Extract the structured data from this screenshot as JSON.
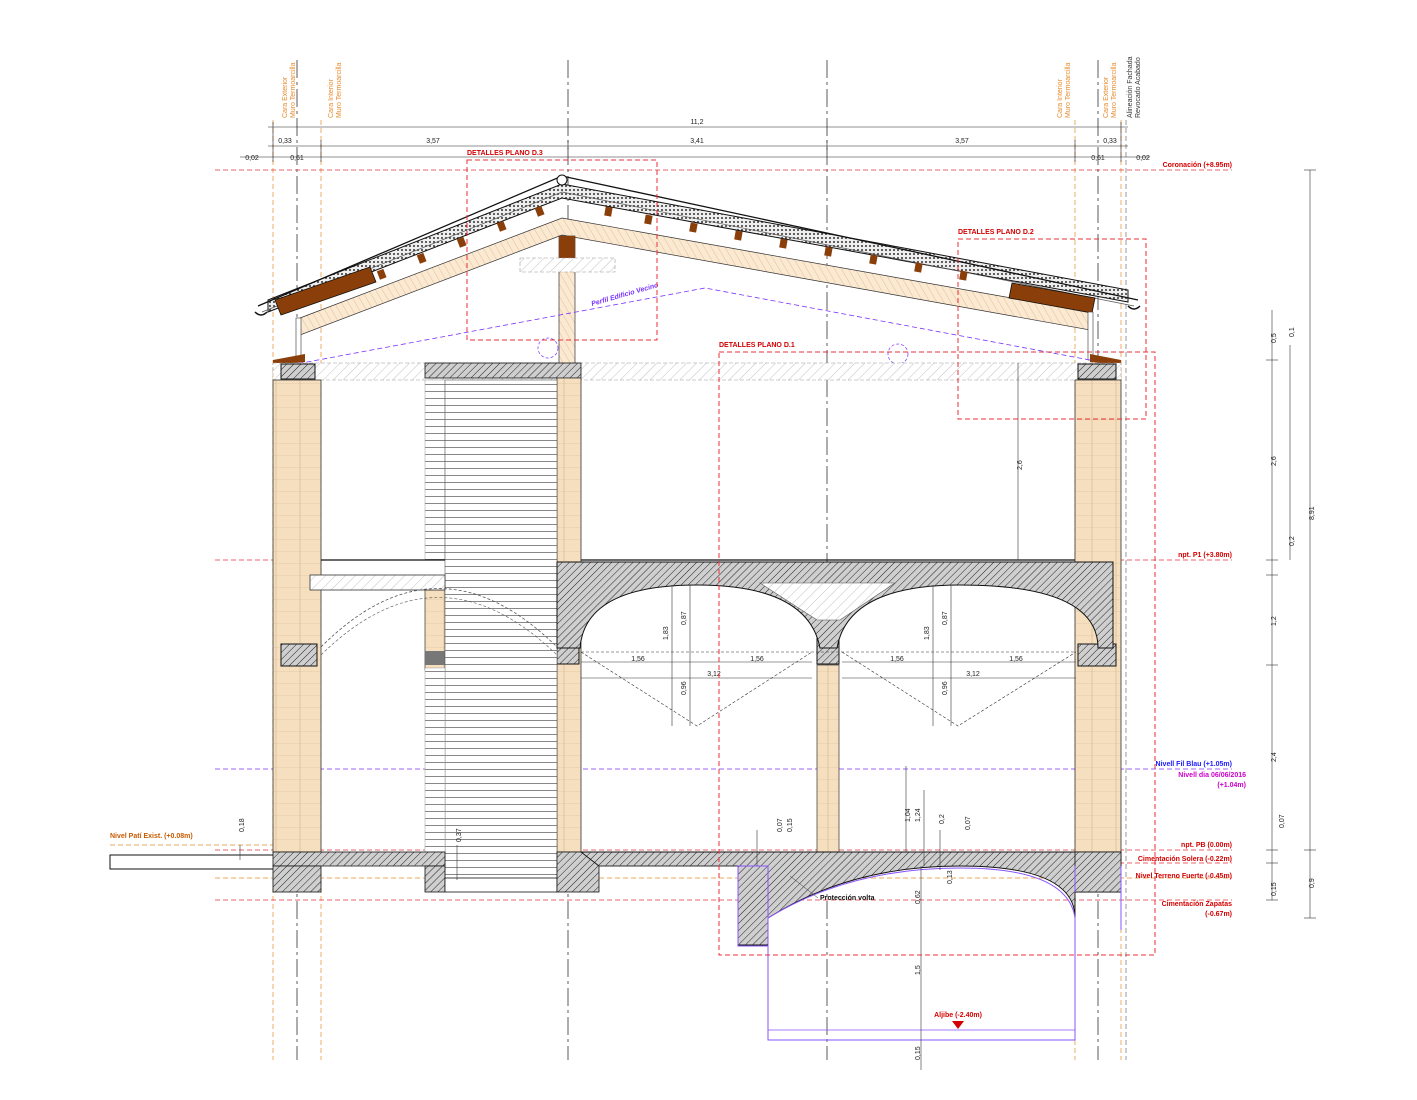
{
  "colors": {
    "level_line": "#e8303a",
    "level_text": "#d40000",
    "axis_orange": "#e88a2a",
    "neighbour": "#7a33ff",
    "water_blue": "#1a1aff",
    "water_magenta": "#cc00cc",
    "cistern": "#8a55ff",
    "brick": "#f6dfbf",
    "timber": "#8a3e0a",
    "black": "#111111"
  },
  "top_labels": {
    "left_ext": [
      "Cara Exterior",
      "Muro Termoarcilla"
    ],
    "left_int": [
      "Cara Interior",
      "Muro Termoarcilla"
    ],
    "right_int": [
      "Cara Interior",
      "Muro Termoarcilla"
    ],
    "right_ext": [
      "Cara Exterior",
      "Muro Termoarcilla"
    ],
    "right_facade": [
      "Alineación Fachada",
      "Revocado Acabado"
    ]
  },
  "top_dims": {
    "total": "11,2",
    "left_wall": "0,33",
    "span_left": "3,57",
    "span_center": "3,41",
    "span_right": "3,57",
    "right_wall": "0,33",
    "left_a": "0,02",
    "left_b": "0,61",
    "right_b": "0,61",
    "right_a": "0,02"
  },
  "detail_boxes": {
    "d3": "DETALLES PLANO D.3",
    "d2": "DETALLES PLANO D.2",
    "d1": "DETALLES PLANO D.1"
  },
  "neighbour_label": "Perfil Edificio Vecino",
  "levels": {
    "coronacion": "Coronación (+8.95m)",
    "p1": "npt. P1 (+3.80m)",
    "filblau": "Nivell Fil Blau (+1.05m)",
    "nivell_dia": "Nivell dia 06/06/2016",
    "nivell_dia_value": "(+1.04m)",
    "pb": "npt. PB (0.00m)",
    "solera": "Cimentación Solera (-0.22m)",
    "terreno": "Nivel Terreno Fuerte (-0.45m)",
    "zapatas": "Cimentación Zapatas",
    "zapatas_value": "(-0.67m)",
    "patio": "Nivel Patí Exist. (+0.08m)",
    "aljibe": "Aljibe (-2.40m)"
  },
  "vault_dims": {
    "half_span": "1,56",
    "full_span": "3,12",
    "rise_total": "1,83",
    "rise_upper": "0,87",
    "rise_lower": "0,96"
  },
  "inner_dims": {
    "upper_height": "2,6",
    "patio_offset": "0,18",
    "stair_depth": "0,37",
    "slab_a": "0,07",
    "slab_b": "0,15",
    "cistern_h1": "1,04",
    "cistern_h2": "1,24",
    "cistern_c": "0,2",
    "cistern_d": "0,07",
    "cistern_e": "0,62",
    "cistern_f": "0,13",
    "cistern_depth": "1,5",
    "cistern_bottom": "0,15"
  },
  "proteccion_label": "Protección volta",
  "right_dims": {
    "total": "8,91",
    "r1": "0,5",
    "r2": "0,1",
    "r3": "2,6",
    "r4": "0,2",
    "r5": "1,2",
    "r6": "2,4",
    "r7": "0,07",
    "r8": "0,15",
    "r9": "0,9"
  }
}
